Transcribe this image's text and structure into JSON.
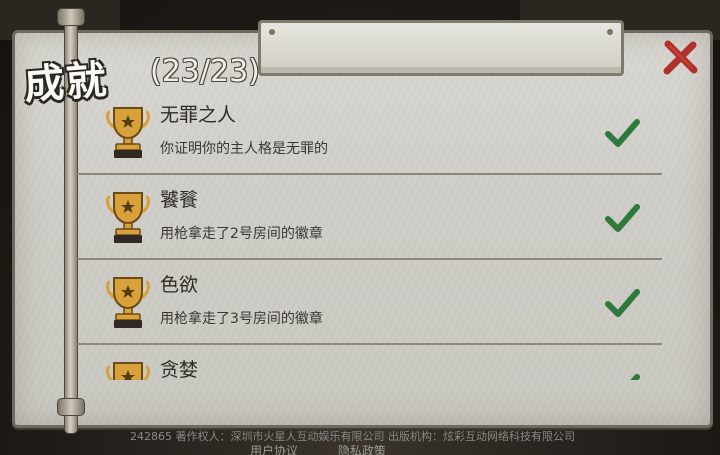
{
  "header": {
    "title": "成就",
    "count": "(23/23)"
  },
  "achievements": [
    {
      "name": "无罪之人",
      "desc": "你证明你的主人格是无罪的",
      "completed": true
    },
    {
      "name": "饕餮",
      "desc": "用枪拿走了2号房间的徽章",
      "completed": true
    },
    {
      "name": "色欲",
      "desc": "用枪拿走了3号房间的徽章",
      "completed": true
    },
    {
      "name": "贪婪",
      "desc": "",
      "completed": true
    }
  ],
  "footer": {
    "legal": "242865 著作权人：深圳市火星人互动娱乐有限公司 出版机构：炫彩互动网络科技有限公司",
    "user_agreement": "用户协议",
    "privacy_policy": "隐私政策"
  },
  "colors": {
    "check": "#2e7a3c",
    "close": "#b0302c",
    "trophy_gold": "#d9a13a",
    "panel": "#d6d5cf"
  },
  "icons": {
    "close": "close-icon",
    "trophy": "trophy-icon",
    "check": "checkmark-icon"
  }
}
